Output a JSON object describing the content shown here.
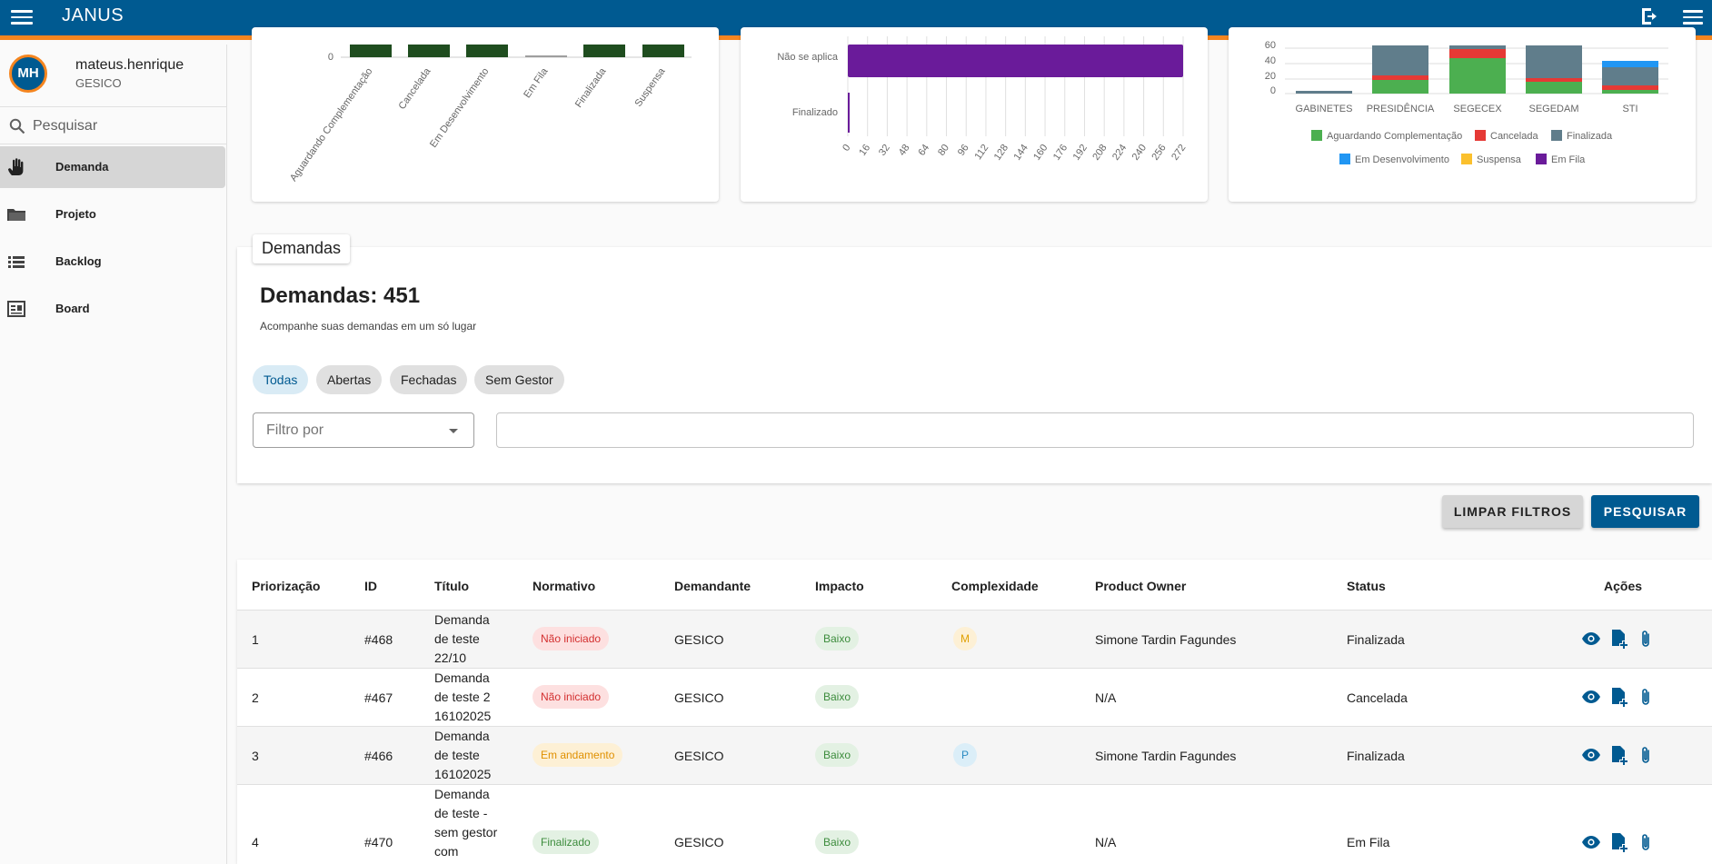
{
  "app": {
    "title": "JANUS"
  },
  "user": {
    "initials": "MH",
    "username": "mateus.henrique",
    "org": "GESICO"
  },
  "search": {
    "placeholder": "Pesquisar"
  },
  "sidebar": {
    "items": [
      {
        "label": "Demanda",
        "icon": "hand-icon",
        "active": true
      },
      {
        "label": "Projeto",
        "icon": "folder-icon"
      },
      {
        "label": "Backlog",
        "icon": "list-icon"
      },
      {
        "label": "Board",
        "icon": "board-icon"
      }
    ]
  },
  "chart_data": [
    {
      "type": "bar",
      "categories": [
        "Aguardando Complementação",
        "Cancelada",
        "Em Desenvolvimento",
        "Em Fila",
        "Finalizada",
        "Suspensa"
      ],
      "y_tick_visible": "0",
      "colors": [
        "#1f4d1f"
      ]
    },
    {
      "type": "bar",
      "orientation": "horizontal",
      "categories": [
        "Não se aplica",
        "Finalizado"
      ],
      "values": [
        272,
        1
      ],
      "x_ticks": [
        "0",
        "16",
        "32",
        "48",
        "64",
        "80",
        "96",
        "112",
        "128",
        "144",
        "160",
        "176",
        "192",
        "208",
        "224",
        "240",
        "256",
        "272"
      ],
      "color": "#6a1b9a"
    },
    {
      "type": "bar",
      "stacked": true,
      "categories": [
        "GABINETES",
        "PRESIDÊNCIA",
        "SEGECEX",
        "SEGEDAM",
        "STI"
      ],
      "y_ticks": [
        "0",
        "20",
        "40",
        "60"
      ],
      "legend": [
        "Aguardando Complementação",
        "Cancelada",
        "Finalizada",
        "Em Desenvolvimento",
        "Suspensa",
        "Em Fila"
      ],
      "legend_colors": [
        "#4caf50",
        "#e53935",
        "#607d8b",
        "#2196f3",
        "#fbc02d",
        "#6a1b9a"
      ],
      "legend_position": "bottom"
    }
  ],
  "demandas": {
    "tab": "Demandas",
    "title": "Demandas: 451",
    "subtitle": "Acompanhe suas demandas em um só lugar",
    "chips": [
      "Todas",
      "Abertas",
      "Fechadas",
      "Sem Gestor"
    ],
    "filter_placeholder": "Filtro por",
    "clear_label": "LIMPAR FILTROS",
    "search_label": "PESQUISAR"
  },
  "table": {
    "headers": [
      "Priorização",
      "ID",
      "Título",
      "Normativo",
      "Demandante",
      "Impacto",
      "Complexidade",
      "Product Owner",
      "Status",
      "Ações"
    ],
    "rows": [
      {
        "prio": "1",
        "id": "#468",
        "title": [
          "Demanda",
          "de teste",
          "22/10"
        ],
        "normativo": "Não iniciado",
        "demandante": "GESICO",
        "impacto": "Baixo",
        "complexidade": "M",
        "po": "Simone Tardin Fagundes",
        "status": "Finalizada"
      },
      {
        "prio": "2",
        "id": "#467",
        "title": [
          "Demanda",
          "de teste 2",
          "16102025"
        ],
        "normativo": "Não iniciado",
        "demandante": "GESICO",
        "impacto": "Baixo",
        "complexidade": "",
        "po": "N/A",
        "status": "Cancelada"
      },
      {
        "prio": "3",
        "id": "#466",
        "title": [
          "Demanda",
          "de teste",
          "16102025"
        ],
        "normativo": "Em andamento",
        "demandante": "GESICO",
        "impacto": "Baixo",
        "complexidade": "P",
        "po": "Simone Tardin Fagundes",
        "status": "Finalizada"
      },
      {
        "prio": "4",
        "id": "#470",
        "title": [
          "Demanda",
          "de teste -",
          "sem gestor",
          "com"
        ],
        "normativo": "Finalizado",
        "demandante": "GESICO",
        "impacto": "Baixo",
        "complexidade": "",
        "po": "N/A",
        "status": "Em Fila"
      }
    ]
  }
}
